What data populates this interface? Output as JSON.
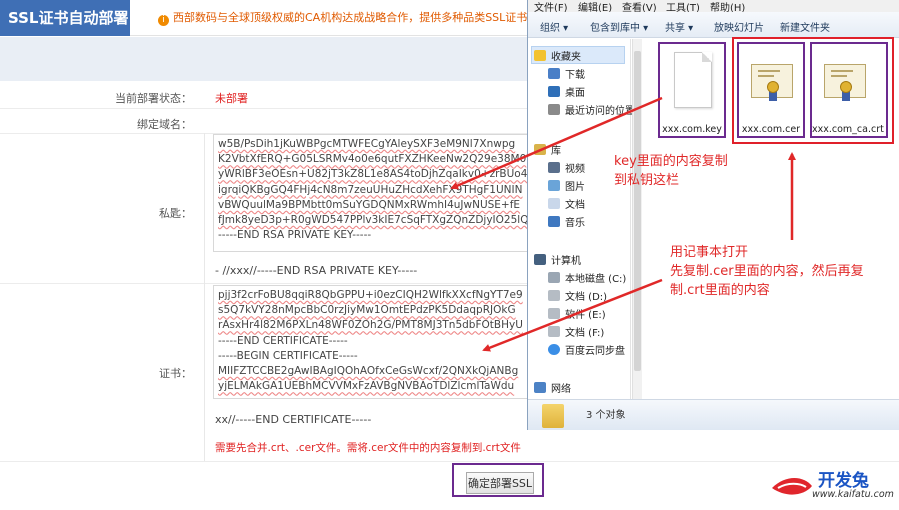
{
  "page": {
    "brand": "SSL证书自动部署",
    "notice": "西部数码与全球顶级权威的CA机构达成战略合作，提供多种品类SSL证书",
    "status_label": "当前部署状态：",
    "status_value": "未部署",
    "domain_label": "绑定域名：",
    "key_label": "私匙：",
    "key_lines": [
      "w5B/PsDih1jKuWBPgcMTWFECgYAleySXF3eM9Nl7Xnwpg",
      "K2VbtXfERQ+G05LSRMv4o0e6qutFXZHKeeNw2Q29e38M0",
      "yWRlBF3eOEsn+U82jT3kZ8L1e8AS4toDjhZqaIkv0+zrBUo4",
      "igrqiQKBgGQ4FHj4cN8m7zeuUHuZHcdXehFX9THgF1UNIN",
      "vBWQuulMa9BPMbtt0mSuYGDQNMxRWmhI4uJwNUSE+fE",
      "fJmk8yeD3p+R0gWD547PPlv3kIE7cSqFTXgZQnZDjyIO25lQ",
      "-----END RSA PRIVATE KEY-----"
    ],
    "key_after": "- //xxx//-----END RSA PRIVATE KEY-----",
    "cert_label": "证书：",
    "cert_lines": [
      "pjj3f2crFoBU8qqiR8QbGPPU+i0ezCIQH2WlfkXXcfNgYT7e9",
      "s5Q7kVY28nMpcBbC0rzJiyMw1OmtEPdzPK5DdaqpRJOkG",
      "rAsxHr4l82M6PXLn48WF0ZOh2G/PMT8MJ3Tn5dbFOtBHyU",
      "-----END CERTIFICATE-----",
      "-----BEGIN CERTIFICATE-----",
      "MIIFZTCCBE2gAwIBAgIQOhAOfxCeGsWcxf/2QNXkQjANBg",
      "yjELMAkGA1UEBhMCVVMxFzAVBgNVBAoTDlZlcmlTaWdu"
    ],
    "cert_after": "xx//-----END CERTIFICATE-----",
    "hint": "需要先合并.crt、.cer文件。需将.cer文件中的内容复制到.crt文件",
    "submit": "确定部署SSL"
  },
  "explorer": {
    "menu": [
      "文件(F)",
      "编辑(E)",
      "查看(V)",
      "工具(T)",
      "帮助(H)"
    ],
    "toolbar": [
      "组织 ▾",
      "包含到库中 ▾",
      "共享 ▾",
      "放映幻灯片",
      "新建文件夹"
    ],
    "nav": [
      "收藏夹",
      "下载",
      "桌面",
      "最近访问的位置",
      "库",
      "视频",
      "图片",
      "文档",
      "音乐",
      "计算机",
      "本地磁盘 (C:)",
      "文档 (D:)",
      "软件 (E:)",
      "文档 (F:)",
      "百度云同步盘",
      "网络"
    ],
    "files": [
      {
        "name": "xxx.com.key",
        "icon": "blank-document-icon"
      },
      {
        "name": "xxx.com.cer",
        "icon": "certificate-icon"
      },
      {
        "name": "xxx.com_ca.crt",
        "icon": "certificate-icon"
      }
    ],
    "status": "3 个对象"
  },
  "annotations": {
    "key_note": [
      "key里面的内容复制",
      "到私钥这栏"
    ],
    "cert_note": [
      "用记事本打开",
      "先复制.cer里面的内容，然后再复",
      "制.crt里面的内容"
    ]
  },
  "watermark": {
    "name": "开发兔",
    "url": "www.kaifatu.com"
  },
  "colors": {
    "brand_bg": "#3f6fb5",
    "annotation_red": "#e02828",
    "frame_purple": "#6b2a8f",
    "frame_red": "#e0202a"
  }
}
